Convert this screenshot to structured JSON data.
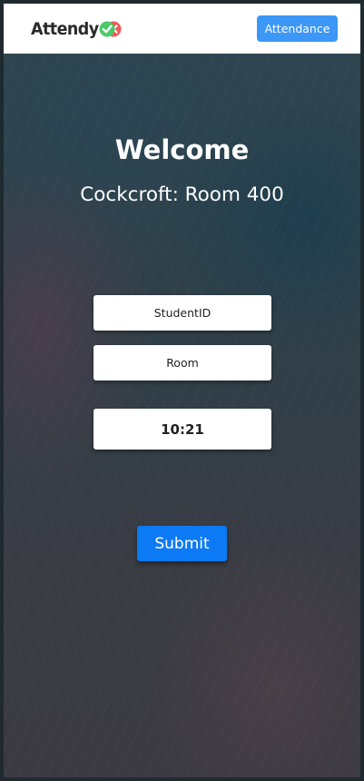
{
  "header": {
    "logo_text": "Attendy",
    "logo_icon": "check-x-icon",
    "attendance_label": "Attendance"
  },
  "main": {
    "title": "Welcome",
    "location": "Cockcroft: Room 400",
    "student_id_placeholder": "StudentID",
    "room_placeholder": "Room",
    "time_value": "10:21",
    "submit_label": "Submit"
  },
  "colors": {
    "primary": "#0d7af5",
    "header_button": "#3d97f6",
    "logo_check": "#4cc96a",
    "logo_x": "#f05a5a"
  }
}
